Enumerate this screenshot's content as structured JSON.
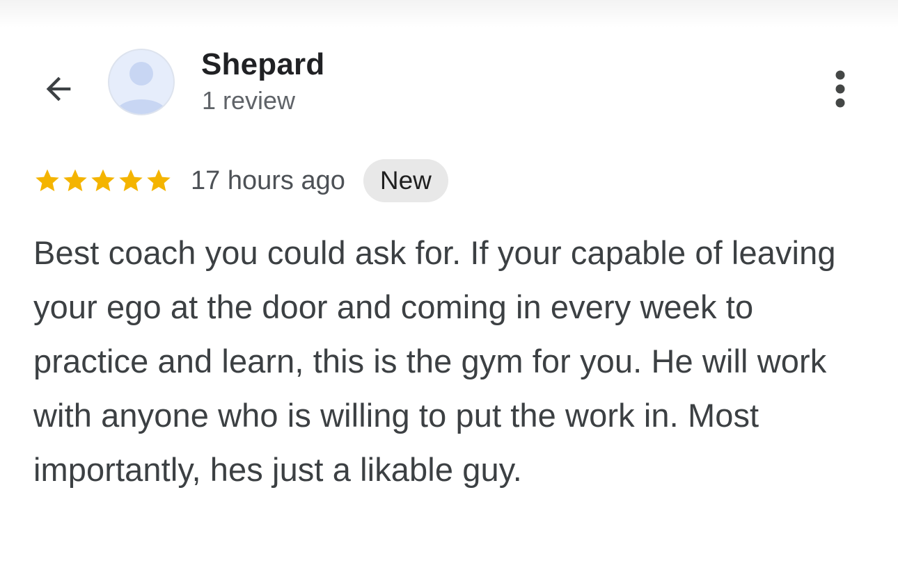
{
  "reviewer": {
    "name": "Shepard",
    "review_count": "1 review"
  },
  "icons": {
    "back": "arrow-back-icon",
    "avatar": "person-avatar-icon",
    "more": "more-vert-icon",
    "star": "star-icon"
  },
  "review": {
    "rating": 5,
    "max_rating": 5,
    "time": "17 hours ago",
    "badge": "New",
    "text": "Best coach you could ask for. If your capable of leaving your ego at the door and coming in every week to practice and learn, this is the gym for you. He will work with anyone who is willing to put the work in. Most importantly, hes just a likable guy."
  },
  "colors": {
    "star": "#f4b400",
    "badge_bg": "#e8e8e8",
    "avatar_bg": "#e6edfb",
    "avatar_fg": "#c8d6f3"
  }
}
